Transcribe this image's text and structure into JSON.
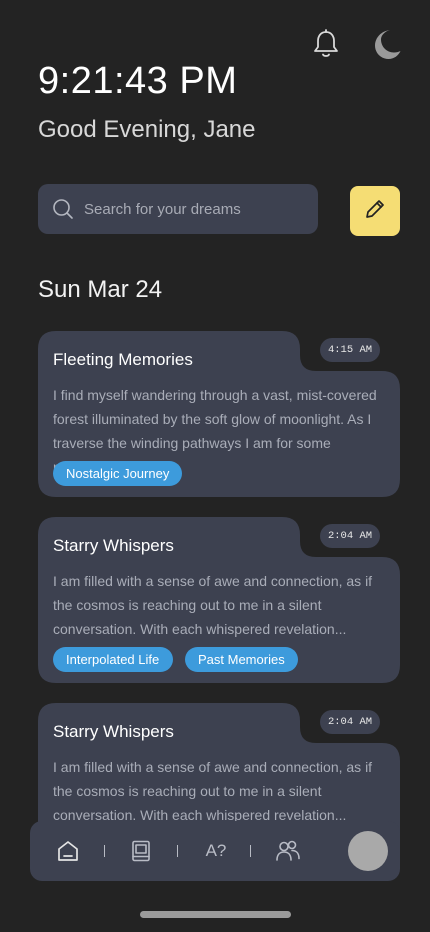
{
  "header": {
    "time": "9:21:43 PM",
    "greeting": "Good Evening, Jane",
    "icons": [
      "bell-icon",
      "moon-icon"
    ]
  },
  "search": {
    "placeholder": "Search for your dreams",
    "value": ""
  },
  "actions": {
    "new_entry_icon": "pencil-icon",
    "accent_color": "#f5dd74"
  },
  "feed": {
    "date": "Sun Mar 24",
    "entries": [
      {
        "title": "Fleeting Memories",
        "time": "4:15 AM",
        "excerpt": "I find myself wandering through a vast, mist-covered forest illuminated by the soft glow of moonlight. As I traverse the winding pathways I am for some reason...",
        "tags": [
          "Nostalgic Journey"
        ]
      },
      {
        "title": "Starry Whispers",
        "time": "2:04 AM",
        "excerpt": "I am filled with a sense of awe and connection, as if the cosmos is reaching out to me in a silent conversation. With each whispered revelation...",
        "tags": [
          "Interpolated Life",
          "Past Memories"
        ]
      },
      {
        "title": "Starry Whispers",
        "time": "2:04 AM",
        "excerpt": "I am filled with a sense of awe and connection, as if the cosmos is reaching out to me in a silent conversation. With each whispered revelation...",
        "tags": []
      }
    ]
  },
  "nav": {
    "items": [
      "home-icon",
      "journal-icon",
      "dictionary-icon",
      "community-icon"
    ],
    "dictionary_label": "A?"
  },
  "colors": {
    "background": "#232323",
    "card": "#3d4150",
    "tag": "#3d9bdc"
  }
}
